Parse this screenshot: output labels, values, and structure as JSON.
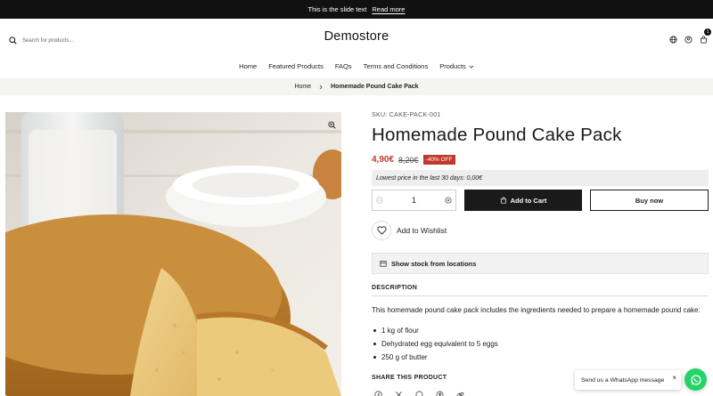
{
  "announcement": {
    "text": "This is the slide text",
    "link": "Read more"
  },
  "header": {
    "search_placeholder": "Search for products...",
    "logo": "Demostore",
    "icons": [
      "globe-icon",
      "user-icon",
      "cart-icon"
    ],
    "cart_count": "1"
  },
  "nav": {
    "items": [
      "Home",
      "Featured Products",
      "FAQs",
      "Terms and Conditions",
      "Products"
    ]
  },
  "breadcrumb": {
    "home": "Home",
    "current": "Homemade Pound Cake Pack"
  },
  "product": {
    "sku": "SKU: CAKE-PACK-001",
    "title": "Homemade Pound Cake Pack",
    "price": "4,90€",
    "compare_price": "8,20€",
    "discount_badge": "-40% OFF",
    "lowest_price": "Lowest price in the last 30 days: 0,00€",
    "quantity": "1",
    "add_to_cart": "Add to Cart",
    "buy_now": "Buy now",
    "wishlist": "Add to Wishlist",
    "stock_button": "Show stock from locations"
  },
  "description": {
    "heading": "DESCRIPTION",
    "intro": "This homemade pound cake pack includes the ingredients needed to prepare a homemade pound cake:",
    "items": [
      "1 kg of flour",
      "Dehydrated egg equivalent to 5 eggs",
      "250 g of butter"
    ]
  },
  "share": {
    "heading": "SHARE THIS PRODUCT",
    "icons": [
      "facebook-icon",
      "x-icon",
      "whatsapp-icon",
      "pinterest-icon",
      "link-icon"
    ]
  },
  "whatsapp": {
    "message": "Send us a WhatsApp message",
    "close": "×"
  },
  "colors": {
    "accent_red": "#c0392b",
    "dark": "#1a1a1a",
    "whatsapp_green": "#25d366"
  }
}
